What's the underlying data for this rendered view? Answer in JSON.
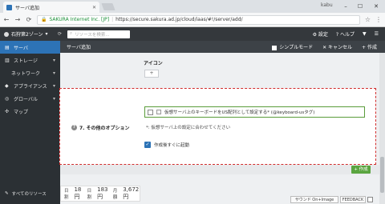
{
  "browser": {
    "tab_title": "サーバ追加",
    "user": "kabu",
    "secure_label": "SAKURA Internet Inc. [JP]",
    "url": "https://secure.sakura.ad.jp/cloud/iaas/#!/server/add/"
  },
  "header": {
    "zone": "石狩第2ゾーン",
    "search_placeholder": "リソースを検索...",
    "settings": "設定",
    "help": "ヘルプ"
  },
  "sidebar": {
    "items": [
      {
        "label": "サーバ"
      },
      {
        "label": "ストレージ"
      },
      {
        "label": "ネットワーク"
      },
      {
        "label": "アプライアンス"
      },
      {
        "label": "グローバル"
      },
      {
        "label": "マップ"
      }
    ],
    "all_resources": "すべてのリソース"
  },
  "toolbar": {
    "breadcrumb": "サーバ追加",
    "simple_mode": "シンプルモード",
    "cancel": "キャンセル",
    "create": "作成"
  },
  "form": {
    "icon_label": "アイコン",
    "add_button": "+",
    "other_options_title": "7. その他のオプション",
    "keyboard_option": "仮想サーバ上のキーボードをUS配列として設定する* (@keyboard-usタグ)",
    "keyboard_note": "*: 仮想サーバ上の設定に合わせてください",
    "boot_after_create": "作成後すぐに起動",
    "create_button": "作成"
  },
  "pricing": {
    "daily_label": "日割",
    "daily_value": "18円",
    "daily2_label": "日割",
    "daily2_value": "183円",
    "monthly_label": "月額",
    "monthly_value": "3,672円"
  },
  "footer": {
    "sound": "サウンド On+Image",
    "feedback": "FEEDBACK"
  },
  "colors": {
    "accent": "#2d73b6",
    "dashed_border": "#d12c2c",
    "create_green": "#5aa540"
  }
}
